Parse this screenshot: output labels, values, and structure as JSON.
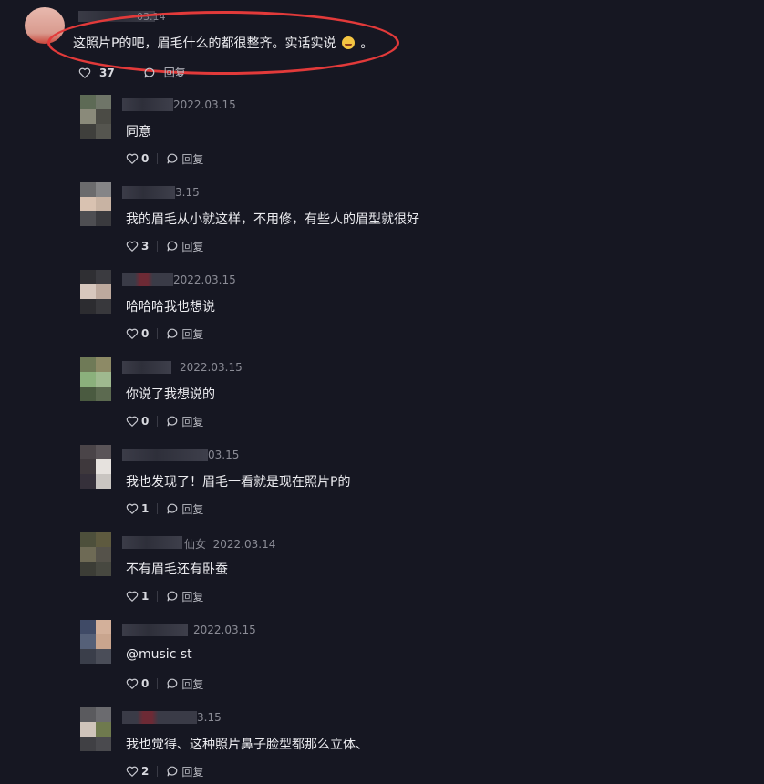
{
  "top_comment": {
    "date": "03.14",
    "text": "这照片P的吧，眉毛什么的都很整齐。实话实说",
    "text_end": "。",
    "likes": "37",
    "reply_label": "回复"
  },
  "replies": [
    {
      "user_suffix": "",
      "date": "2022.03.15",
      "text": "同意",
      "likes": "0",
      "reply_label": "回复"
    },
    {
      "user_suffix": "",
      "date": "3.15",
      "text": "我的眉毛从小就这样，不用修，有些人的眉型就很好",
      "likes": "3",
      "reply_label": "回复"
    },
    {
      "user_suffix": "",
      "date": "2022.03.15",
      "text": "哈哈哈我也想说",
      "likes": "0",
      "reply_label": "回复"
    },
    {
      "user_suffix": "",
      "date": "2022.03.15",
      "text": "你说了我想说的",
      "likes": "0",
      "reply_label": "回复"
    },
    {
      "user_suffix": "",
      "date": "03.15",
      "text": "我也发现了！眉毛一看就是现在照片P的",
      "likes": "1",
      "reply_label": "回复"
    },
    {
      "user_suffix": "仙女",
      "date": "2022.03.14",
      "text": "不有眉毛还有卧蚕",
      "likes": "1",
      "reply_label": "回复"
    },
    {
      "user_suffix": "",
      "date": "2022.03.15",
      "text": "@music st",
      "likes": "0",
      "reply_label": "回复"
    },
    {
      "user_suffix": "",
      "date": "3.15",
      "text": "我也觉得、这种照片鼻子脸型都那么立体、",
      "likes": "2",
      "reply_label": "回复"
    }
  ]
}
